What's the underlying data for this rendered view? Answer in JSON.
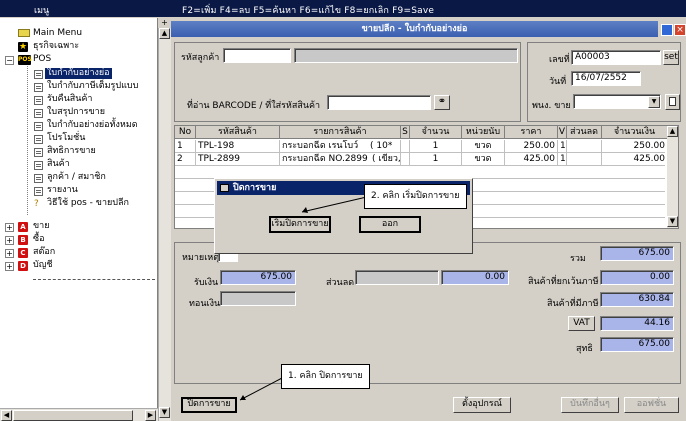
{
  "topbar": {
    "menu": "เมนู",
    "keys": "F2=เพิ่ม  F4=ลบ  F5=ค้นหา  F6=แก้ไข  F8=ยกเลิก  F9=Save"
  },
  "tree": {
    "items": [
      {
        "label": "Main Menu"
      },
      {
        "label": "ธุรกิจเฉพาะ"
      },
      {
        "label": "POS"
      },
      {
        "label": "ใบกำกับอย่างย่อ"
      },
      {
        "label": "ใบกำกับภาษีเต็มรูปแบบ"
      },
      {
        "label": "รับคืนสินค้า"
      },
      {
        "label": "ใบสรุปการขาย"
      },
      {
        "label": "ใบกำกับอย่างย่อทั้งหมด"
      },
      {
        "label": "โปรโมชั่น"
      },
      {
        "label": "สิทธิการขาย"
      },
      {
        "label": "สินค้า"
      },
      {
        "label": "ลูกค้า / สมาชิก"
      },
      {
        "label": "รายงาน"
      },
      {
        "label": "วิธีใช้ pos - ขายปลีก"
      },
      {
        "label": "ขาย"
      },
      {
        "label": "ซื้อ"
      },
      {
        "label": "สต๊อก"
      },
      {
        "label": "บัญชี"
      }
    ]
  },
  "window": {
    "title": "ขายปลีก - ใบกำกับอย่างย่อ"
  },
  "form": {
    "customer_code_label": "รหัสลูกค้า",
    "customer_code_value": "",
    "customer_name_value": "",
    "barcode_label": "ที่อ่าน BARCODE / ที่ใส่รหัสสินค้า",
    "barcode_value": "",
    "doc_no_label": "เลขที่",
    "doc_no_value": "A00003",
    "set_label": "set",
    "date_label": "วันที่",
    "date_value": "16/07/2552",
    "salesman_label": "พนง. ขาย",
    "salesman_value": ""
  },
  "grid": {
    "headers": [
      "No",
      "รหัสสินค้า",
      "รายการสินค้า",
      "S",
      "จำนวน",
      "หน่วยนับ",
      "ราคา",
      "V",
      "ส่วนลด",
      "จำนวนเงิน"
    ],
    "rows": [
      {
        "no": "1",
        "code": "TPL-198",
        "name": "กระบอกฉีด เรนโบว์",
        "name2": "( 10*",
        "qty": "1",
        "unit": "ขวด",
        "price": "250.00",
        "v": "1",
        "disc": "",
        "amount": "250.00"
      },
      {
        "no": "2",
        "code": "TPL-2899",
        "name": "กระบอกฉีด NO.2899",
        "name2": "( เขียว,",
        "qty": "1",
        "unit": "ขวด",
        "price": "425.00",
        "v": "1",
        "disc": "",
        "amount": "425.00"
      }
    ]
  },
  "totals": {
    "note_label": "หมายเหตุ",
    "received_label": "รับเงิน",
    "received_value": "675.00",
    "discount_label": "ส่วนลด",
    "discount_value": "0.00",
    "change_label": "ทอนเงิน",
    "change_value": "",
    "sum_label": "รวม",
    "sum_value": "675.00",
    "exempt_label": "สินค้าที่ยกเว้นภาษี",
    "exempt_value": "0.00",
    "taxable_label": "สินค้าที่มีภาษี",
    "taxable_value": "630.84",
    "vat_label": "VAT",
    "vat_value": "44.16",
    "net_label": "สุทธิ",
    "net_value": "675.00"
  },
  "bottom": {
    "close_sale_label": "ปิดการขาย",
    "setup_label": "ตั้งอุปกรณ์",
    "save_other_label": "บันทึกอื่นๆ",
    "options_label": "ออฟชั่น"
  },
  "dialog": {
    "title": "ปิดการขาย",
    "open_sale_label": "เริ่มปิดการขาย",
    "exit_label": "ออก"
  },
  "callouts": {
    "step1": "1. คลิก  ปิดการขาย",
    "step2": "2. คลิก  เริ่มปิดการขาย"
  }
}
